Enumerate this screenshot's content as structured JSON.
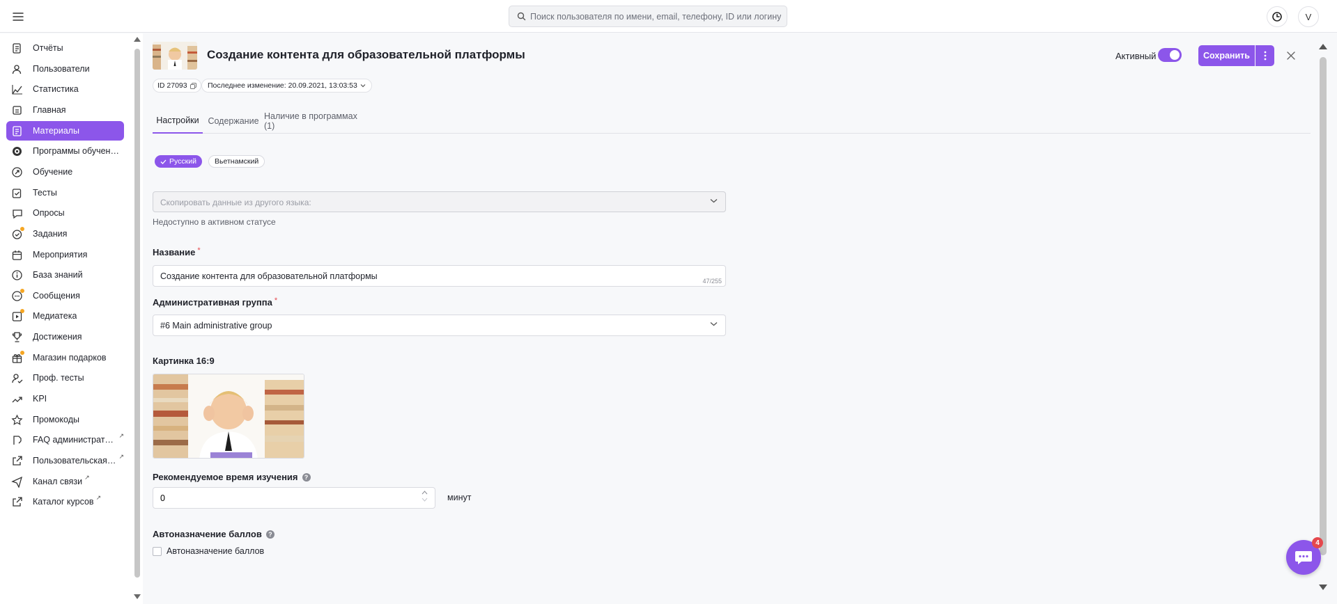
{
  "header": {
    "search_placeholder": "Поиск пользователя по имени, email, телефону, ID или логину",
    "avatar_initial": "V"
  },
  "sidebar": {
    "items": [
      {
        "label": "Отчёты",
        "icon": "report-icon",
        "active": false,
        "external": false,
        "dot": false
      },
      {
        "label": "Пользователи",
        "icon": "users-icon",
        "active": false,
        "external": false,
        "dot": false
      },
      {
        "label": "Статистика",
        "icon": "stats-icon",
        "active": false,
        "external": false,
        "dot": false
      },
      {
        "label": "Главная",
        "icon": "home-icon",
        "active": false,
        "external": false,
        "dot": false
      },
      {
        "label": "Материалы",
        "icon": "materials-icon",
        "active": true,
        "external": false,
        "dot": false
      },
      {
        "label": "Программы обучения",
        "icon": "programs-icon",
        "active": false,
        "external": false,
        "dot": false
      },
      {
        "label": "Обучение",
        "icon": "learning-icon",
        "active": false,
        "external": false,
        "dot": false
      },
      {
        "label": "Тесты",
        "icon": "tests-icon",
        "active": false,
        "external": false,
        "dot": false
      },
      {
        "label": "Опросы",
        "icon": "surveys-icon",
        "active": false,
        "external": false,
        "dot": false
      },
      {
        "label": "Задания",
        "icon": "tasks-icon",
        "active": false,
        "external": false,
        "dot": true
      },
      {
        "label": "Мероприятия",
        "icon": "events-icon",
        "active": false,
        "external": false,
        "dot": false
      },
      {
        "label": "База знаний",
        "icon": "knowledge-icon",
        "active": false,
        "external": false,
        "dot": false
      },
      {
        "label": "Сообщения",
        "icon": "messages-icon",
        "active": false,
        "external": false,
        "dot": true
      },
      {
        "label": "Медиатека",
        "icon": "media-icon",
        "active": false,
        "external": false,
        "dot": true
      },
      {
        "label": "Достижения",
        "icon": "trophy-icon",
        "active": false,
        "external": false,
        "dot": false
      },
      {
        "label": "Магазин подарков",
        "icon": "gift-icon",
        "active": false,
        "external": false,
        "dot": true
      },
      {
        "label": "Проф. тесты",
        "icon": "prof-tests-icon",
        "active": false,
        "external": false,
        "dot": false
      },
      {
        "label": "KPI",
        "icon": "kpi-icon",
        "active": false,
        "external": false,
        "dot": false
      },
      {
        "label": "Промокоды",
        "icon": "star-icon",
        "active": false,
        "external": false,
        "dot": false
      },
      {
        "label": "FAQ администратора",
        "icon": "faq-icon",
        "active": false,
        "external": true,
        "dot": false
      },
      {
        "label": "Пользовательская версия",
        "icon": "external-link-icon",
        "active": false,
        "external": true,
        "dot": false
      },
      {
        "label": "Канал связи",
        "icon": "send-icon",
        "active": false,
        "external": true,
        "dot": false
      },
      {
        "label": "Каталог курсов",
        "icon": "external-link-icon",
        "active": false,
        "external": true,
        "dot": false
      }
    ]
  },
  "material": {
    "title": "Создание контента для образовательной платформы",
    "id_label": "ID 27093",
    "last_modified": "Последнее изменение: 20.09.2021, 13:03:53",
    "active_label": "Активный",
    "active": true,
    "save_label": "Сохранить"
  },
  "tabs": [
    {
      "label": "Настройки",
      "active": true
    },
    {
      "label": "Содержание",
      "active": false
    },
    {
      "label": "Наличие в программах (1)",
      "active": false
    }
  ],
  "languages": [
    {
      "label": "Русский",
      "selected": true
    },
    {
      "label": "Вьетнамский",
      "selected": false
    }
  ],
  "form": {
    "copy_placeholder": "Скопировать данные из другого языка:",
    "copy_hint": "Недоступно в активном статусе",
    "name_label": "Название",
    "name_value": "Создание контента для образовательной платформы",
    "name_counter": "47/255",
    "group_label": "Административная группа",
    "group_value": "#6 Main administrative group",
    "image_label": "Картинка 16:9",
    "time_label": "Рекомендуемое время изучения",
    "time_value": "0",
    "time_unit": "минут",
    "points_label": "Автоназначение баллов",
    "points_checkbox_label": "Автоназначение баллов",
    "points_checked": false
  },
  "chat": {
    "badge_count": "4"
  },
  "colors": {
    "accent": "#8c56ea",
    "badge": "#e5484d",
    "dot": "#f5a623"
  }
}
